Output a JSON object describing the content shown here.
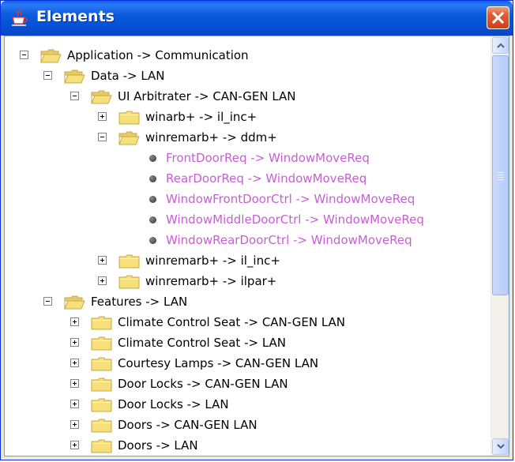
{
  "window": {
    "title": "Elements"
  },
  "tree": {
    "n0": "Application -> Communication",
    "n1": "Data -> LAN",
    "n2": "UI Arbitrater -> CAN-GEN LAN",
    "n3": "winarb+ -> il_inc+",
    "n4": "winremarb+ -> ddm+",
    "n5": "FrontDoorReq -> WindowMoveReq",
    "n6": "RearDoorReq -> WindowMoveReq",
    "n7": "WindowFrontDoorCtrl -> WindowMoveReq",
    "n8": "WindowMiddleDoorCtrl -> WindowMoveReq",
    "n9": "WindowRearDoorCtrl -> WindowMoveReq",
    "n10": "winremarb+ -> il_inc+",
    "n11": "winremarb+ -> ilpar+",
    "n12": "Features -> LAN",
    "n13": "Climate Control Seat -> CAN-GEN LAN",
    "n14": "Climate Control Seat -> LAN",
    "n15": "Courtesy Lamps -> CAN-GEN LAN",
    "n16": "Door Locks -> CAN-GEN LAN",
    "n17": "Door Locks -> LAN",
    "n18": "Doors -> CAN-GEN LAN",
    "n19": "Doors -> LAN"
  },
  "colors": {
    "titlebar": "#0650d4",
    "leaf_text": "#c85ed6",
    "folder": "#f5e07c"
  },
  "icons": {
    "title": "java-cup-icon",
    "close": "close-icon",
    "folder_open": "folder-open-icon",
    "folder_closed": "folder-closed-icon",
    "leaf": "bullet-icon"
  }
}
